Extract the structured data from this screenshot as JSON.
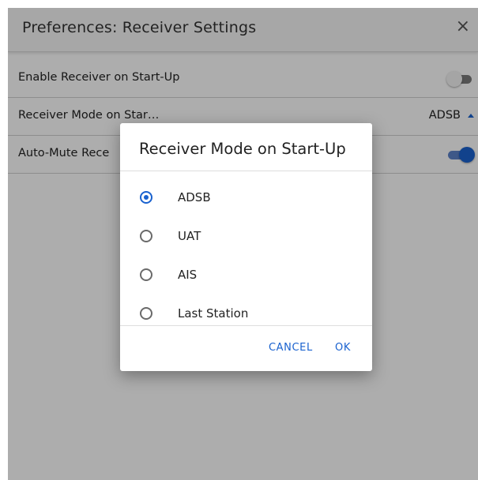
{
  "window": {
    "title": "Preferences: Receiver Settings",
    "close_glyph": "×"
  },
  "settings": {
    "rows": [
      {
        "label": "Enable Receiver on Start-Up",
        "control": "toggle",
        "on": false
      },
      {
        "label": "Receiver Mode on Star…",
        "control": "select",
        "value": "ADSB"
      },
      {
        "label": "Auto-Mute Rece",
        "control": "toggle",
        "on": true
      }
    ]
  },
  "dialog": {
    "title": "Receiver Mode on Start-Up",
    "options": [
      {
        "label": "ADSB",
        "selected": true
      },
      {
        "label": "UAT",
        "selected": false
      },
      {
        "label": "AIS",
        "selected": false
      },
      {
        "label": "Last Station",
        "selected": false
      }
    ],
    "cancel_label": "CANCEL",
    "ok_label": "OK"
  },
  "colors": {
    "accent": "#1a62cf",
    "overlay": "rgba(0,0,0,0.32)"
  },
  "icons": {
    "close": "close-icon",
    "select_arrow": "chevron-up-icon"
  }
}
